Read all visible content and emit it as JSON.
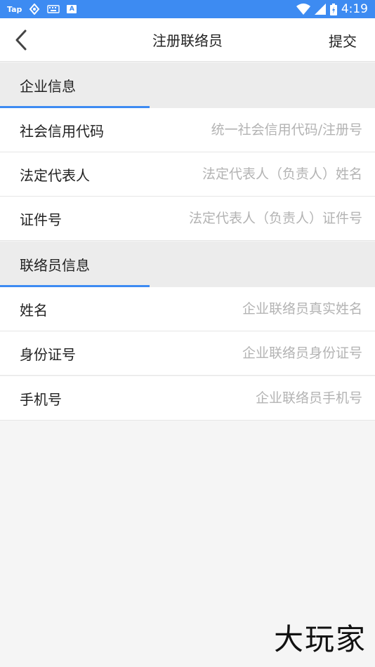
{
  "status_bar": {
    "left_icons": [
      "tap-label",
      "sync-icon",
      "keyboard-icon",
      "a-icon"
    ],
    "tap_label": "Tap",
    "a_label": "A",
    "time": "4:19"
  },
  "nav": {
    "title": "注册联络员",
    "submit_label": "提交"
  },
  "sections": [
    {
      "title": "企业信息",
      "fields": [
        {
          "label": "社会信用代码",
          "placeholder": "统一社会信用代码/注册号",
          "value": ""
        },
        {
          "label": "法定代表人",
          "placeholder": "法定代表人（负责人）姓名",
          "value": ""
        },
        {
          "label": "证件号",
          "placeholder": "法定代表人（负责人）证件号",
          "value": ""
        }
      ]
    },
    {
      "title": "联络员信息",
      "fields": [
        {
          "label": "姓名",
          "placeholder": "企业联络员真实姓名",
          "value": ""
        },
        {
          "label": "身份证号",
          "placeholder": "企业联络员身份证号",
          "value": ""
        },
        {
          "label": "手机号",
          "placeholder": "企业联络员手机号",
          "value": ""
        }
      ]
    }
  ],
  "watermark": "大玩家",
  "colors": {
    "accent": "#3d8bf2",
    "section_bg": "#ececec",
    "placeholder": "#b3b3b3"
  }
}
